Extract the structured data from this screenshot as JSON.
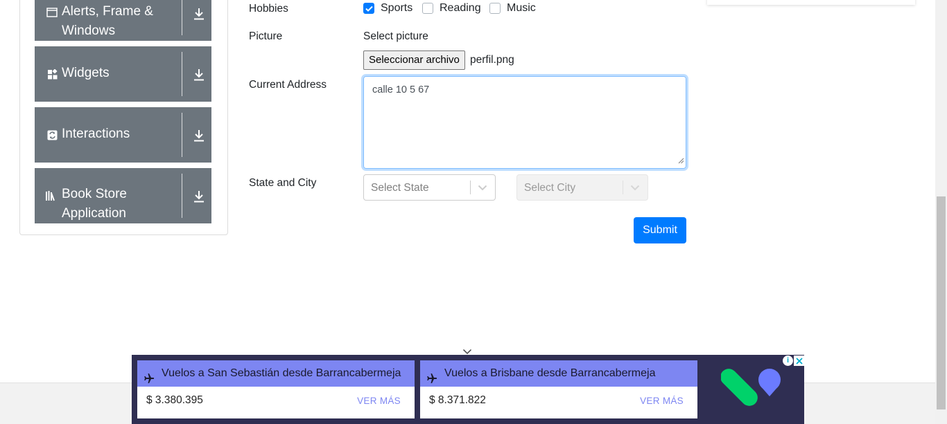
{
  "sidebar": {
    "groups": [
      {
        "label_line1": "Alerts, Frame &",
        "label_line2": "Windows",
        "icon": "window-icon",
        "toggle_icon": "download-arrow-icon"
      },
      {
        "label": "Widgets",
        "icon": "widgets-icon",
        "toggle_icon": "download-arrow-icon"
      },
      {
        "label": "Interactions",
        "icon": "interactions-icon",
        "toggle_icon": "download-arrow-icon"
      },
      {
        "label_line1": "Book Store",
        "label_line2": "Application",
        "icon": "books-icon",
        "toggle_icon": "download-arrow-icon"
      }
    ]
  },
  "form": {
    "hobbies": {
      "label": "Hobbies",
      "options": [
        {
          "label": "Sports",
          "checked": true
        },
        {
          "label": "Reading",
          "checked": false
        },
        {
          "label": "Music",
          "checked": false
        }
      ]
    },
    "picture": {
      "label": "Picture",
      "prompt": "Select picture",
      "button_label": "Seleccionar archivo",
      "file_name": "perfil.png"
    },
    "address": {
      "label": "Current Address",
      "value": "calle 10 5 67"
    },
    "state_city": {
      "label": "State and City",
      "state_placeholder": "Select State",
      "city_placeholder": "Select City",
      "city_disabled": true
    },
    "submit_label": "Submit"
  },
  "ad": {
    "cards": [
      {
        "title": "Vuelos a San Sebastián desde Barrancabermeja",
        "price": "$ 3.380.395",
        "cta": "VER MÁS"
      },
      {
        "title": "Vuelos a Brisbane desde Barrancabermeja",
        "price": "$ 8.371.822",
        "cta": "VER MÁS"
      }
    ],
    "info_symbol": "i",
    "colors": {
      "background": "#2f2e52",
      "accent": "#7d86f2",
      "logo_green": "#00d26a",
      "logo_blue": "#6b7bff"
    }
  },
  "colors": {
    "primary": "#007bff",
    "sidebar_group": "#6c757d",
    "focus_border": "#80bdff"
  }
}
